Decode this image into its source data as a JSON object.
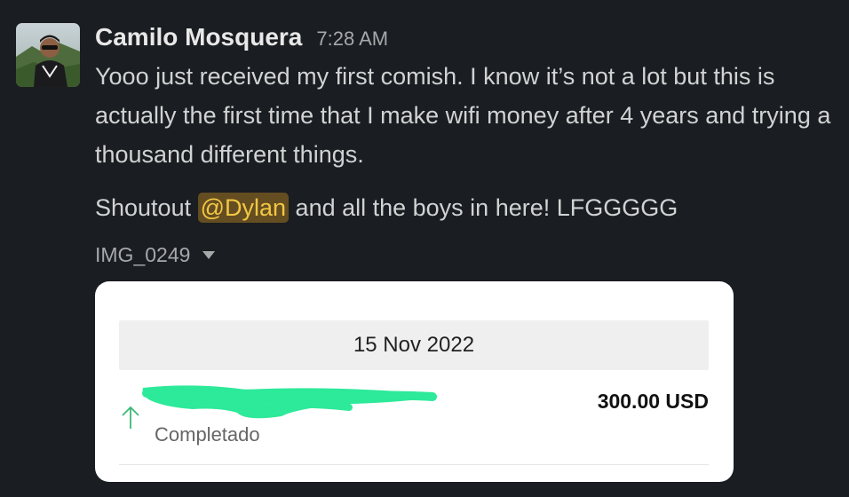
{
  "message": {
    "author": "Camilo Mosquera",
    "time": "7:28 AM",
    "paragraph1": "Yooo just received my first comish. I know it’s not a lot but this is actually the first time that I make wifi money after 4 years and trying a thousand different things.",
    "paragraph2_before": "Shoutout ",
    "mention": "@Dylan",
    "paragraph2_after": " and all the boys in here! LFGGGGG",
    "attachment_name": "IMG_0249"
  },
  "transaction": {
    "date": "15 Nov 2022",
    "amount": "300.00 USD",
    "status": "Completado"
  },
  "colors": {
    "background": "#1a1d21",
    "mention_bg": "#644d20",
    "mention_text": "#f2c744",
    "arrow": "#3cb878",
    "redaction": "#2de99a"
  },
  "icons": {
    "arrow": "arrow-up-icon",
    "caret": "caret-down-icon"
  }
}
